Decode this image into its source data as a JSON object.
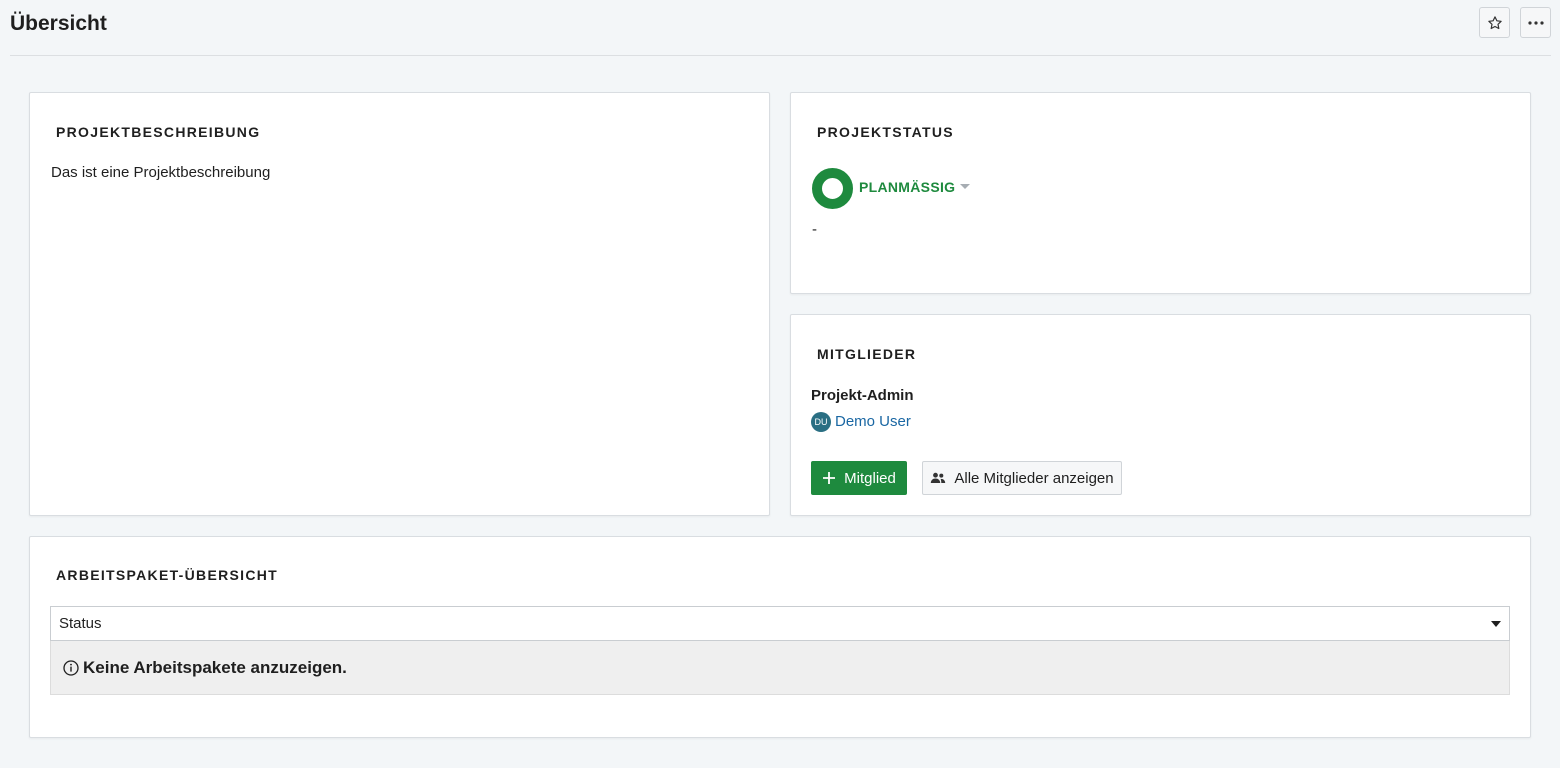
{
  "header": {
    "title": "Übersicht",
    "star_icon": "star-icon",
    "more_icon": "more-icon"
  },
  "description_widget": {
    "title": "PROJEKTBESCHREIBUNG",
    "text": "Das ist eine Projektbeschreibung"
  },
  "status_widget": {
    "title": "PROJEKTSTATUS",
    "status_label": "PLANMÄSSIG",
    "status_color": "#1e8a3e",
    "explanation": "-"
  },
  "members_widget": {
    "title": "MITGLIEDER",
    "role": "Projekt-Admin",
    "members": [
      {
        "initials": "DU",
        "name": "Demo User"
      }
    ],
    "add_button_label": "Mitglied",
    "all_members_button_label": "Alle Mitglieder anzeigen"
  },
  "workpackages_widget": {
    "title": "ARBEITSPAKET-ÜBERSICHT",
    "group_by_selected": "Status",
    "empty_message": "Keine Arbeitspakete anzuzeigen."
  },
  "colors": {
    "accent_green": "#1e8a3e",
    "link_blue": "#1a67a3",
    "avatar_bg": "#2a6f83",
    "page_bg": "#f3f6f8"
  }
}
